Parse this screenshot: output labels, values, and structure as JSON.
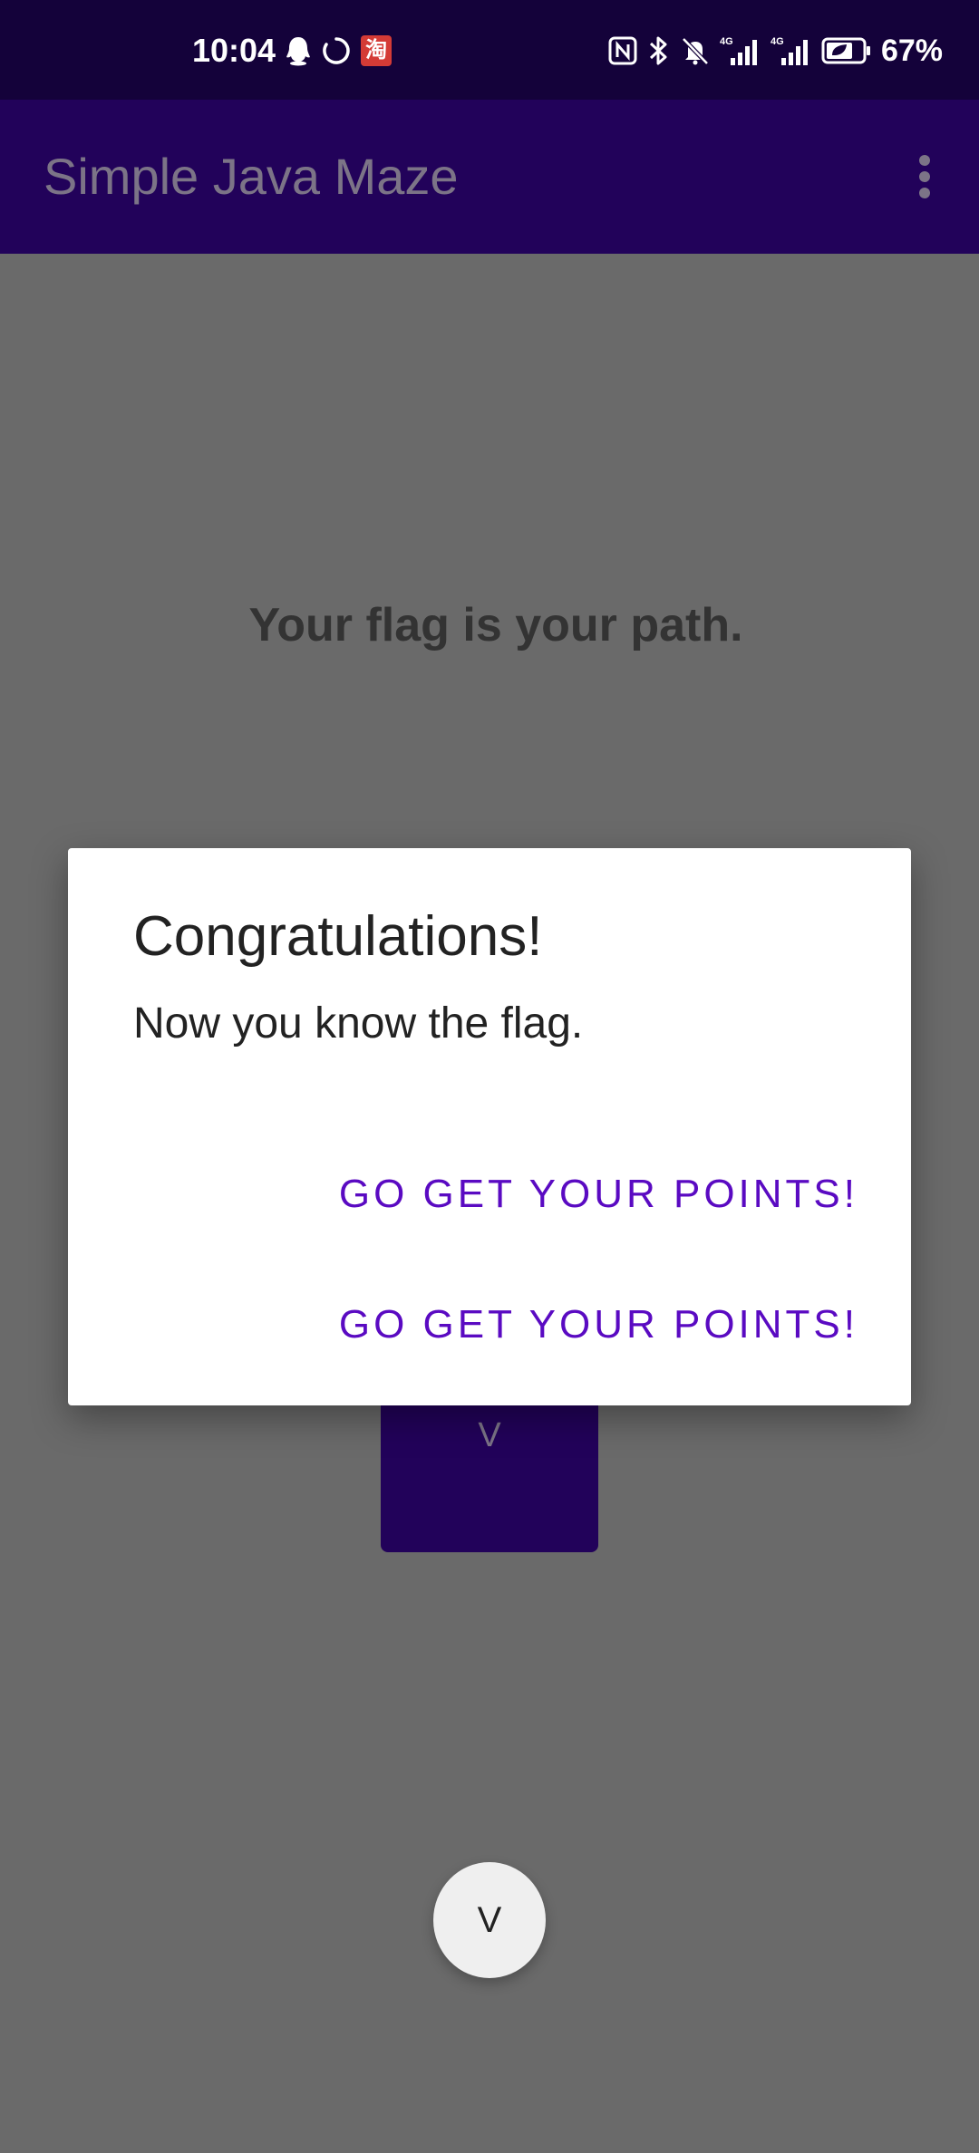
{
  "status_bar": {
    "time": "10:04",
    "taobao_glyph": "淘",
    "battery_percent": "67%",
    "network_label_1": "4G",
    "network_label_2": "4G",
    "icons": [
      "qq-icon",
      "sync-icon",
      "taobao-icon",
      "nfc-icon",
      "bluetooth-icon",
      "mute-icon",
      "signal-icon",
      "signal-icon",
      "battery-icon"
    ]
  },
  "app_bar": {
    "title": "Simple Java Maze",
    "menu_icon": "more-vert-icon"
  },
  "main": {
    "heading": "Your flag is your path.",
    "maze_button_label": "V",
    "fab_label": "V"
  },
  "dialog": {
    "title": "Congratulations!",
    "message": "Now you know the flag.",
    "actions": [
      {
        "label": "GO GET YOUR POINTS!"
      },
      {
        "label": "GO GET YOUR POINTS!"
      }
    ]
  },
  "colors": {
    "status_bar": "#14023a",
    "app_bar": "#22025a",
    "scrim_background": "#6a6a6a",
    "accent": "#5a0ac2",
    "title_text": "#7c7487"
  }
}
